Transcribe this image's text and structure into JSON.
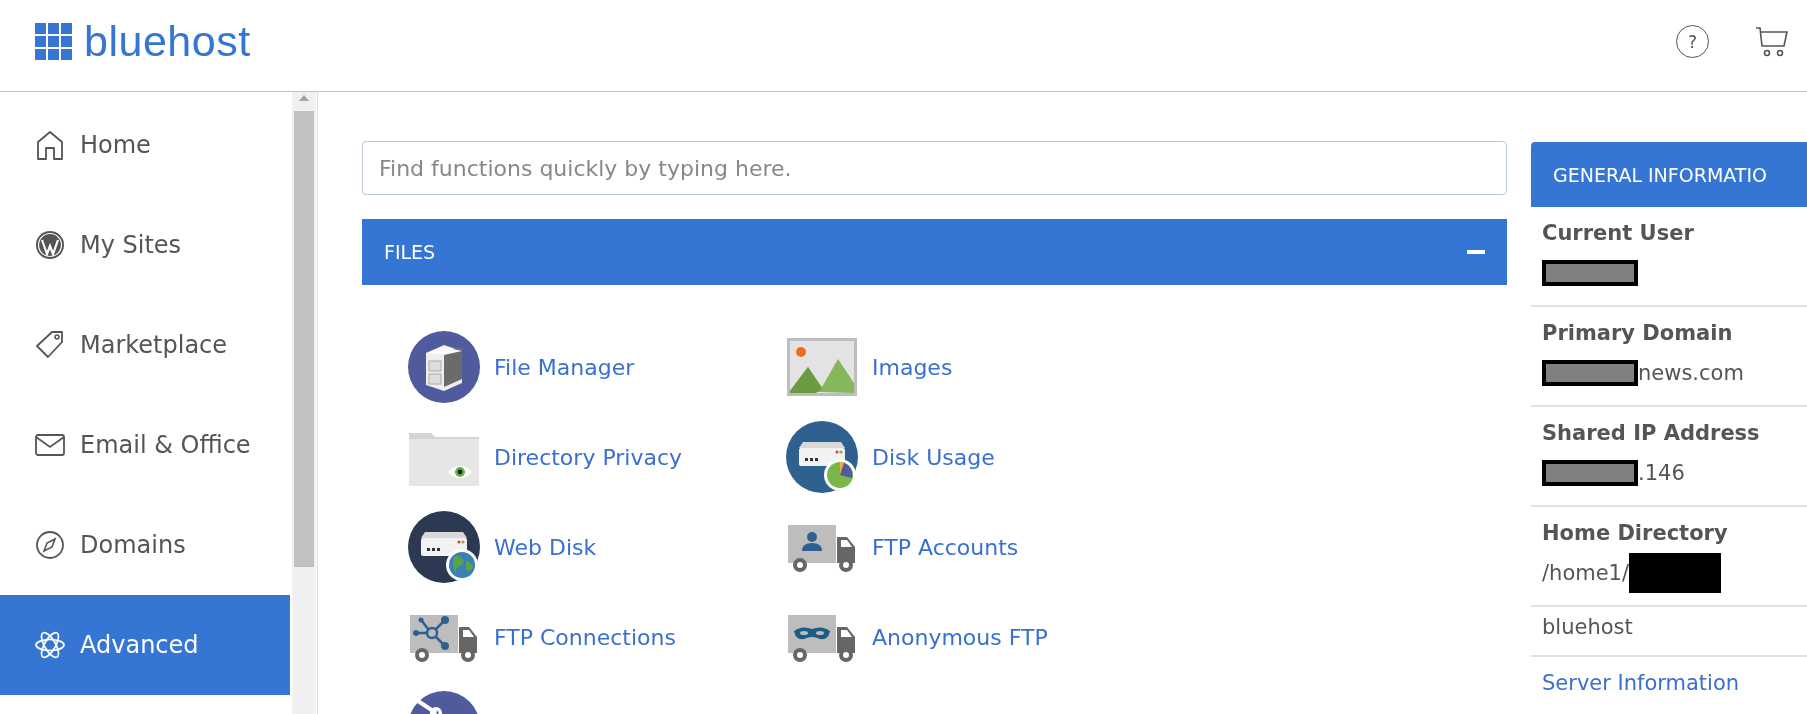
{
  "header": {
    "logo": "bluehost",
    "help_label": "?"
  },
  "sidebar": {
    "items": [
      {
        "label": "Home",
        "selected": false
      },
      {
        "label": "My Sites",
        "selected": false
      },
      {
        "label": "Marketplace",
        "selected": false
      },
      {
        "label": "Email & Office",
        "selected": false
      },
      {
        "label": "Domains",
        "selected": false
      },
      {
        "label": "Advanced",
        "selected": true
      }
    ]
  },
  "search": {
    "placeholder": "Find functions quickly by typing here."
  },
  "files": {
    "title": "FILES",
    "expanded": true,
    "items": [
      {
        "kind": "tool",
        "label": "File Manager"
      },
      {
        "kind": "tool",
        "label": "Images"
      },
      {
        "kind": "tool",
        "label": "Directory Privacy"
      },
      {
        "kind": "tool",
        "label": "Disk Usage"
      },
      {
        "kind": "tool",
        "label": "Web Disk"
      },
      {
        "kind": "tool",
        "label": "FTP Accounts"
      },
      {
        "kind": "tool",
        "label": "FTP Connections"
      },
      {
        "kind": "tool",
        "label": "Anonymous FTP"
      },
      {
        "kind": "partial"
      }
    ]
  },
  "general_information": {
    "title": "GENERAL INFORMATIO",
    "rows": [
      {
        "kind": "field",
        "label": "Current User",
        "redacted": true
      },
      {
        "kind": "field",
        "label": "Primary Domain",
        "value": "news.com",
        "redacted": true
      },
      {
        "kind": "field",
        "label": "Shared IP Address",
        "value": ".146",
        "redacted": true
      },
      {
        "kind": "field",
        "label": "Home Directory",
        "value": "/home1/",
        "redacted": true
      },
      {
        "kind": "text",
        "value": "bluehost"
      },
      {
        "kind": "link",
        "value": "Server Information"
      }
    ]
  }
}
